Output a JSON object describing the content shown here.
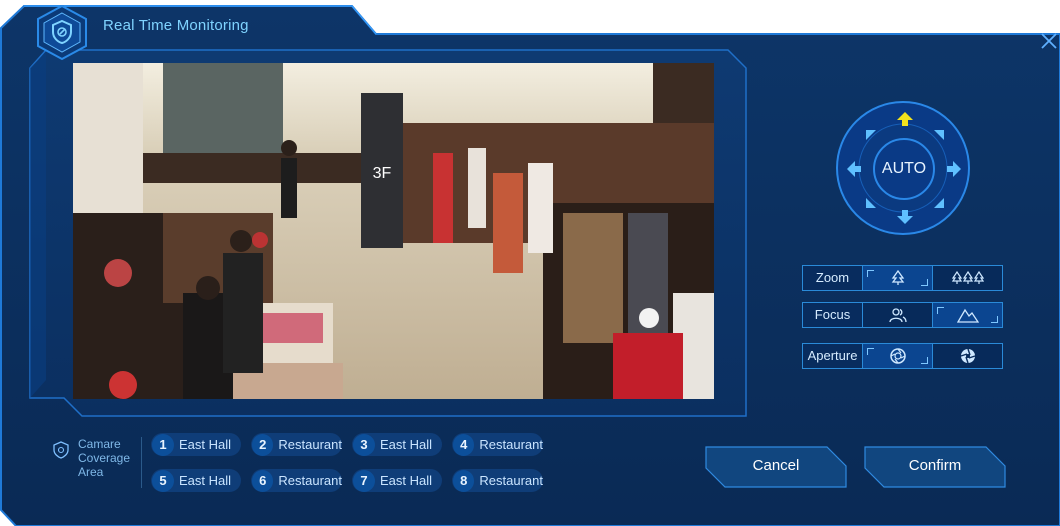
{
  "window": {
    "title": "Real Time Monitoring",
    "close_icon": "close-icon"
  },
  "colors": {
    "panel": "#0b2d5c",
    "border": "#1f7ad8",
    "accent": "#7fd3ff",
    "arrow_up": "#f2e21c"
  },
  "camera_feed": {
    "icon": "camera-feed-image"
  },
  "ptz": {
    "auto_label": "AUTO",
    "icons": [
      "arrow-up-icon",
      "arrow-down-icon",
      "arrow-left-icon",
      "arrow-right-icon"
    ]
  },
  "controls": {
    "zoom": {
      "label": "Zoom",
      "in_icon": "zoom-in-tree-icon",
      "out_icon": "zoom-out-trees-icon"
    },
    "focus": {
      "label": "Focus",
      "near_icon": "focus-near-people-icon",
      "far_icon": "focus-far-mountain-icon"
    },
    "aperture": {
      "label": "Aperture",
      "open_icon": "aperture-open-icon",
      "close_icon": "aperture-close-icon"
    }
  },
  "coverage": {
    "label_line1": "Camare",
    "label_line2": "Coverage",
    "label_line3": "Area",
    "areas": [
      {
        "num": "1",
        "name": "East Hall"
      },
      {
        "num": "2",
        "name": "Restaurant"
      },
      {
        "num": "3",
        "name": "East Hall"
      },
      {
        "num": "4",
        "name": "Restaurant"
      },
      {
        "num": "5",
        "name": "East Hall"
      },
      {
        "num": "6",
        "name": "Restaurant"
      },
      {
        "num": "7",
        "name": "East Hall"
      },
      {
        "num": "8",
        "name": "Restaurant"
      }
    ]
  },
  "actions": {
    "cancel": "Cancel",
    "confirm": "Confirm"
  }
}
